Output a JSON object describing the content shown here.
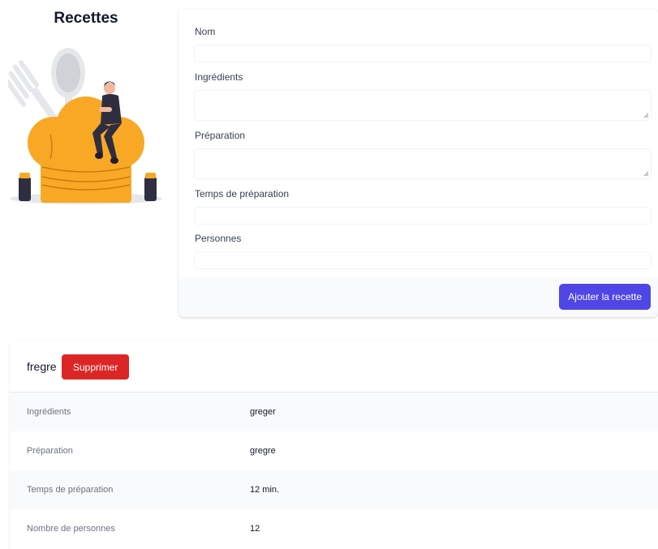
{
  "page": {
    "title": "Recettes"
  },
  "form": {
    "fields": [
      {
        "label": "Nom",
        "value": ""
      },
      {
        "label": "Ingrédients",
        "value": ""
      },
      {
        "label": "Préparation",
        "value": ""
      },
      {
        "label": "Temps de préparation",
        "value": ""
      },
      {
        "label": "Personnes",
        "value": ""
      }
    ],
    "submit_label": "Ajouter la recette"
  },
  "recipe": {
    "name": "fregre",
    "delete_label": "Supprimer",
    "rows": [
      {
        "label": "Ingrédients",
        "value": "greger"
      },
      {
        "label": "Préparation",
        "value": "gregre"
      },
      {
        "label": "Temps de préparation",
        "value": "12 min."
      },
      {
        "label": "Nombre de personnes",
        "value": "12"
      }
    ]
  },
  "colors": {
    "accent": "#4f46e5",
    "danger": "#dc2626",
    "illustration": "#f9a825"
  }
}
